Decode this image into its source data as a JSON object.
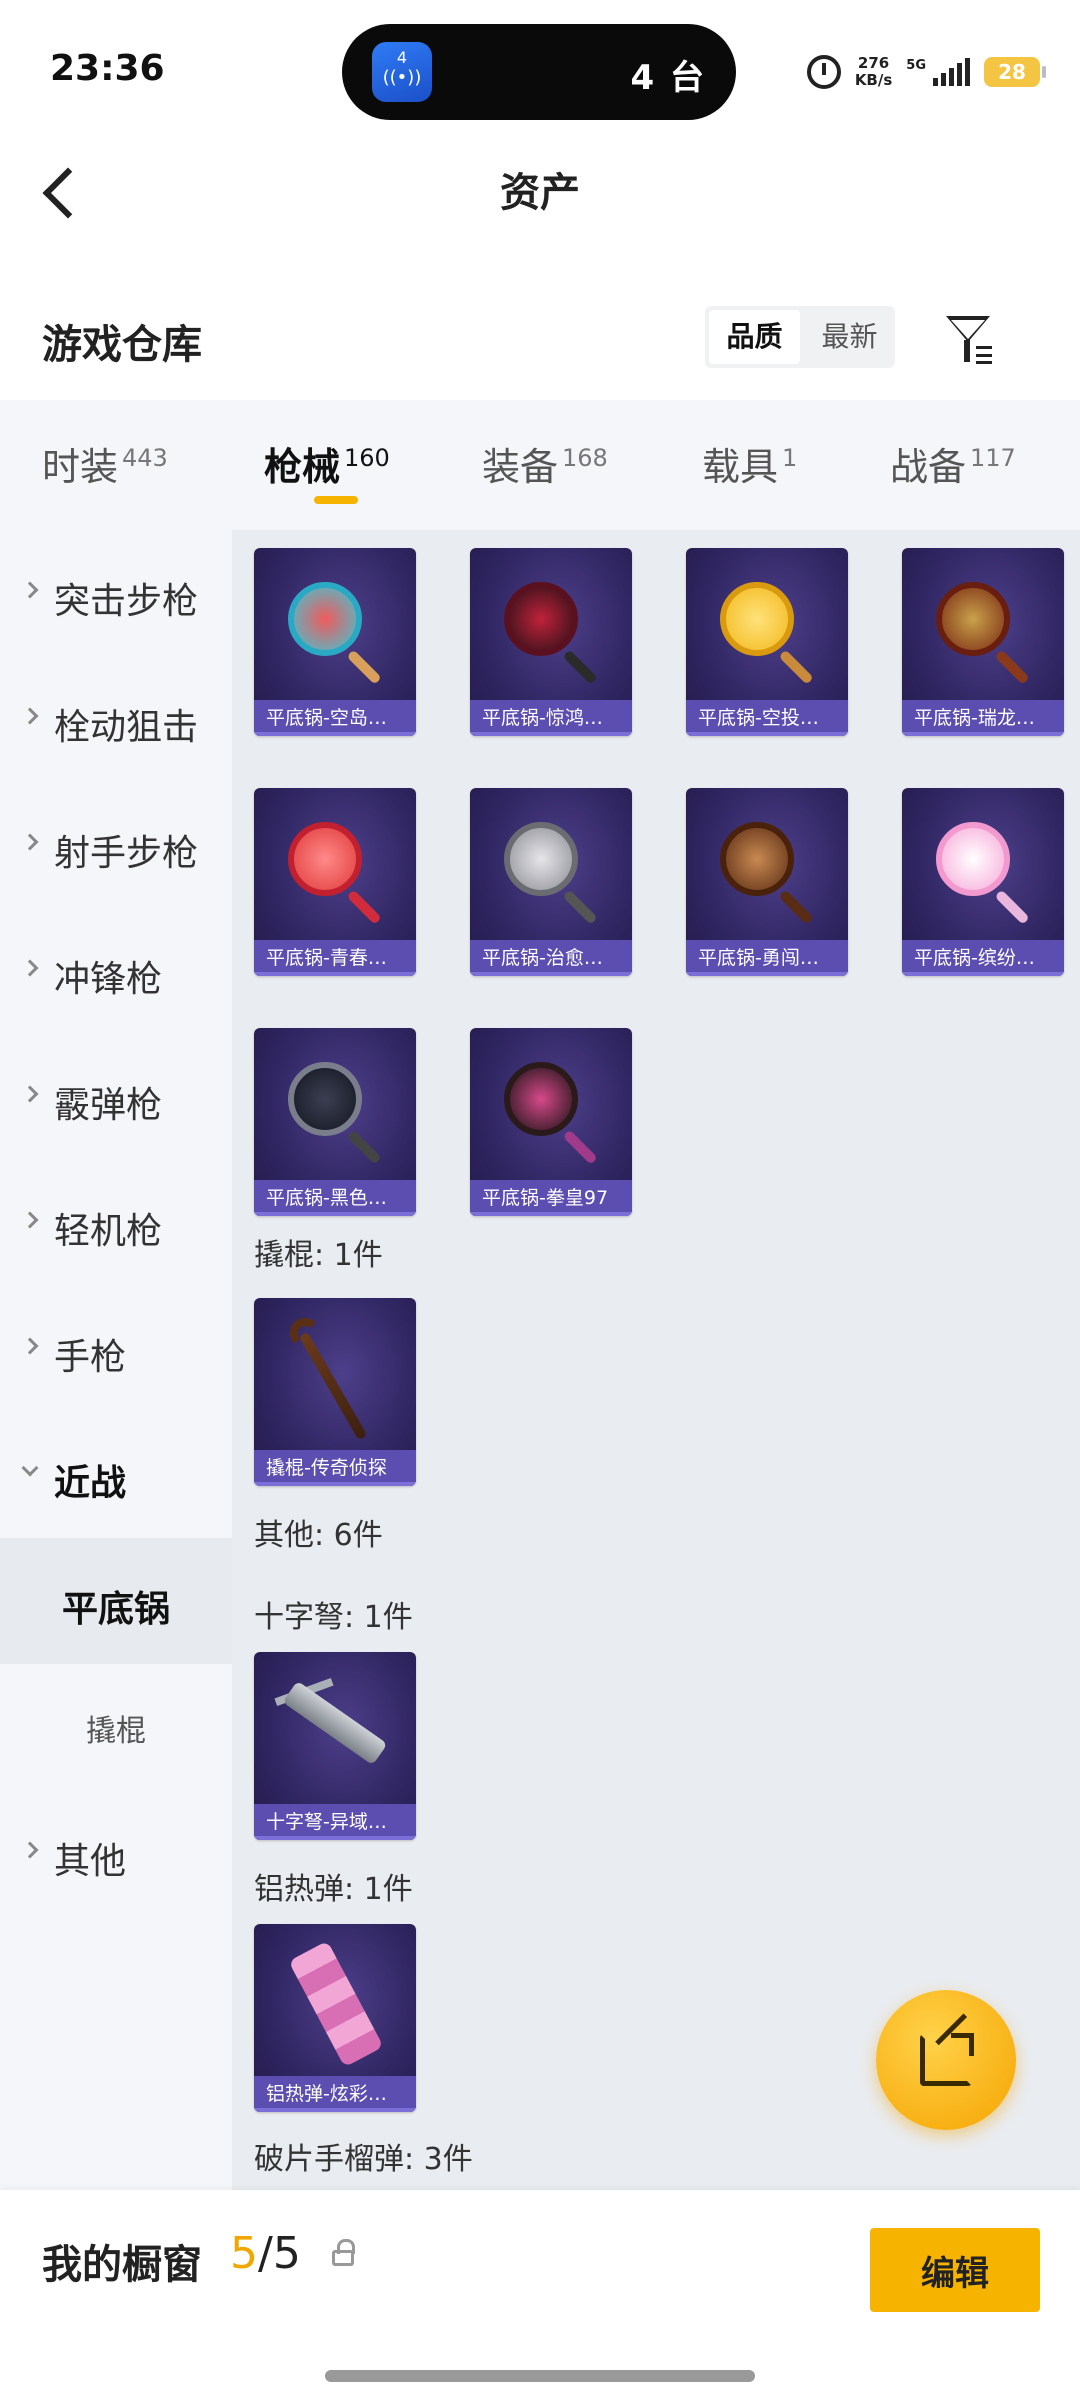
{
  "status_bar": {
    "time": "23:36",
    "island_text": "4 台",
    "island_badge": "4",
    "net_speed_value": "276",
    "net_speed_unit": "KB/s",
    "network_type": "5G",
    "battery": "28"
  },
  "header": {
    "title": "资产"
  },
  "section": {
    "title": "游戏仓库",
    "sort_options": [
      "品质",
      "最新"
    ],
    "active_sort": "品质"
  },
  "tabs": [
    {
      "label": "时装",
      "count": "443",
      "active": false
    },
    {
      "label": "枪械",
      "count": "160",
      "active": true
    },
    {
      "label": "装备",
      "count": "168",
      "active": false
    },
    {
      "label": "载具",
      "count": "1",
      "active": false
    },
    {
      "label": "战备",
      "count": "117",
      "active": false
    }
  ],
  "sidebar": {
    "items": [
      {
        "label": "突击步枪"
      },
      {
        "label": "栓动狙击"
      },
      {
        "label": "射手步枪"
      },
      {
        "label": "冲锋枪"
      },
      {
        "label": "霰弹枪"
      },
      {
        "label": "轻机枪"
      },
      {
        "label": "手枪"
      },
      {
        "label": "近战"
      },
      {
        "label": "平底锅"
      },
      {
        "label": "撬棍"
      },
      {
        "label": "其他"
      }
    ]
  },
  "content": {
    "pan_items": [
      {
        "name": "平底锅-空岛…"
      },
      {
        "name": "平底锅-惊鸿…"
      },
      {
        "name": "平底锅-空投…"
      },
      {
        "name": "平底锅-瑞龙…"
      },
      {
        "name": "平底锅-青春…"
      },
      {
        "name": "平底锅-治愈…"
      },
      {
        "name": "平底锅-勇闯…"
      },
      {
        "name": "平底锅-缤纷…"
      },
      {
        "name": "平底锅-黑色…"
      },
      {
        "name": "平底锅-拳皇97"
      }
    ],
    "crowbar_group": "撬棍: 1件",
    "crowbar_item": "撬棍-传奇侦探",
    "other_group": "其他: 6件",
    "crossbow_group": "十字弩: 1件",
    "crossbow_item": "十字弩-异域…",
    "thermite_group": "铝热弹: 1件",
    "thermite_item": "铝热弹-炫彩…",
    "frag_group": "破片手榴弹: 3件"
  },
  "bottom_bar": {
    "title": "我的橱窗",
    "count_current": "5",
    "count_separator": "/5",
    "edit_label": "编辑"
  },
  "colors": {
    "accent": "#f6b400",
    "card_caption": "#5c4eb0",
    "card_bg": "#2f2560"
  }
}
